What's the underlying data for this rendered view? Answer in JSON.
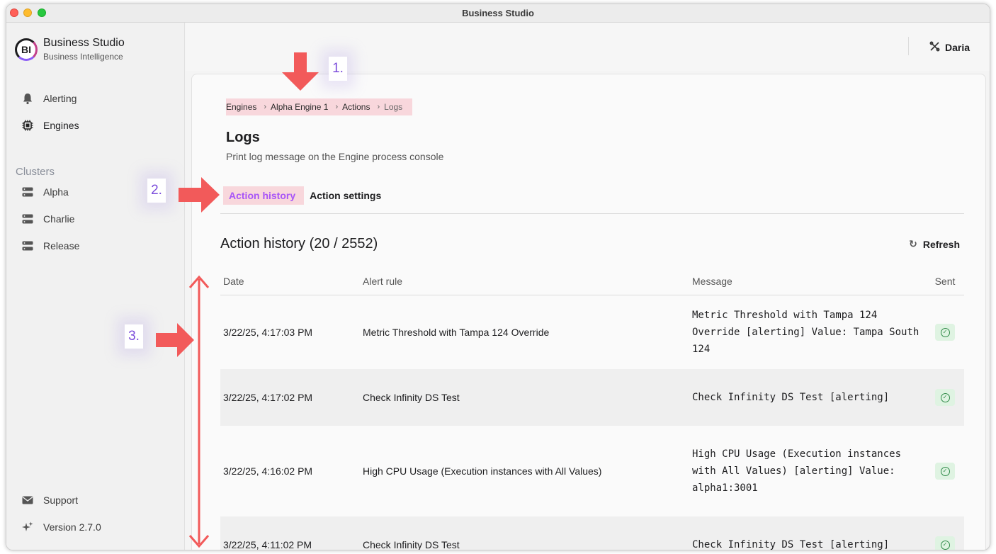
{
  "window": {
    "title": "Business Studio"
  },
  "brand": {
    "logo_text": "BI",
    "name": "Business Studio",
    "subtitle": "Business Intelligence"
  },
  "sidebar": {
    "items": [
      {
        "label": "Alerting",
        "icon": "bell-icon"
      },
      {
        "label": "Engines",
        "icon": "chip-icon"
      }
    ],
    "clusters_label": "Clusters",
    "clusters": [
      {
        "label": "Alpha",
        "icon": "server-icon"
      },
      {
        "label": "Charlie",
        "icon": "server-icon"
      },
      {
        "label": "Release",
        "icon": "server-icon"
      }
    ],
    "footer": [
      {
        "label": "Support",
        "icon": "mail-icon"
      },
      {
        "label": "Version 2.7.0",
        "icon": "sparkles-icon"
      }
    ]
  },
  "topbar": {
    "user_label": "Daria",
    "user_icon": "tools-icon"
  },
  "breadcrumb": [
    "Engines",
    "Alpha Engine 1",
    "Actions",
    "Logs"
  ],
  "page": {
    "title": "Logs",
    "description": "Print log message on the Engine process console"
  },
  "tabs": [
    {
      "label": "Action history",
      "active": true
    },
    {
      "label": "Action settings",
      "active": false
    }
  ],
  "history": {
    "title": "Action history (20 / 2552)",
    "refresh_label": "Refresh",
    "columns": {
      "date": "Date",
      "rule": "Alert rule",
      "message": "Message",
      "sent": "Sent"
    },
    "rows": [
      {
        "date": "3/22/25, 4:17:03 PM",
        "rule": "Metric Threshold with Tampa 124 Override",
        "message": "Metric Threshold with Tampa 124 Override [alerting] Value: Tampa South 124",
        "sent": true
      },
      {
        "date": "3/22/25, 4:17:02 PM",
        "rule": "Check Infinity DS Test",
        "message": "Check Infinity DS Test [alerting]",
        "sent": true
      },
      {
        "date": "3/22/25, 4:16:02 PM",
        "rule": "High CPU Usage (Execution instances with All Values)",
        "message": "High CPU Usage (Execution instances with All Values) [alerting] Value: alpha1:3001",
        "sent": true
      },
      {
        "date": "3/22/25, 4:11:02 PM",
        "rule": "Check Infinity DS Test",
        "message": "Check Infinity DS Test [alerting]",
        "sent": true
      }
    ]
  },
  "annotations": [
    "1.",
    "2.",
    "3."
  ],
  "colors": {
    "accent": "#a855f7",
    "highlight": "#f8d7dc",
    "arrow": "#f25a5a",
    "success": "#2f8a47"
  }
}
